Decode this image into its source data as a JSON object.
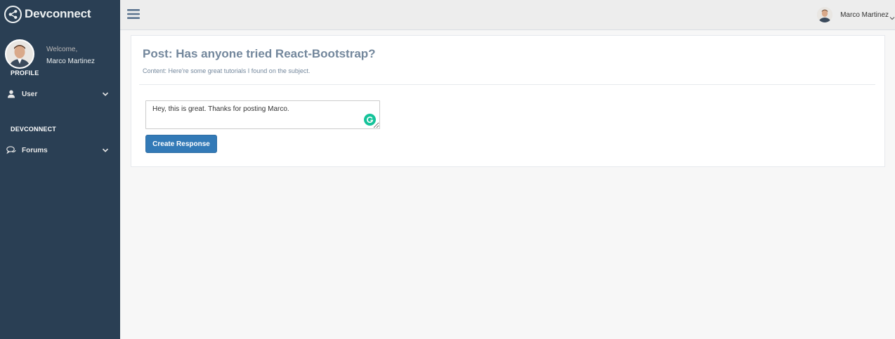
{
  "brand": {
    "name": "Devconnect",
    "icon": "share-icon"
  },
  "sidebar": {
    "welcome_label": "Welcome,",
    "user_name": "Marco Martinez",
    "profile_section": "PROFILE",
    "user_item": {
      "label": "User",
      "icon": "user-icon"
    },
    "devconnect_section": "DEVCONNECT",
    "forums_item": {
      "label": "Forums",
      "icon": "comments-icon"
    }
  },
  "topnav": {
    "user_name": "Marco Martinez"
  },
  "post": {
    "title": "Post: Has anyone tried React-Bootstrap?",
    "content": "Content: Here're some great tutorials I found on the subject."
  },
  "reply": {
    "value": "Hey, this is great. Thanks for posting Marco.",
    "button_label": "Create Response"
  },
  "colors": {
    "sidebar_bg": "#2a3f54",
    "primary_button": "#337ab7",
    "title_text": "#73879c",
    "grammarly": "#15c39a"
  }
}
